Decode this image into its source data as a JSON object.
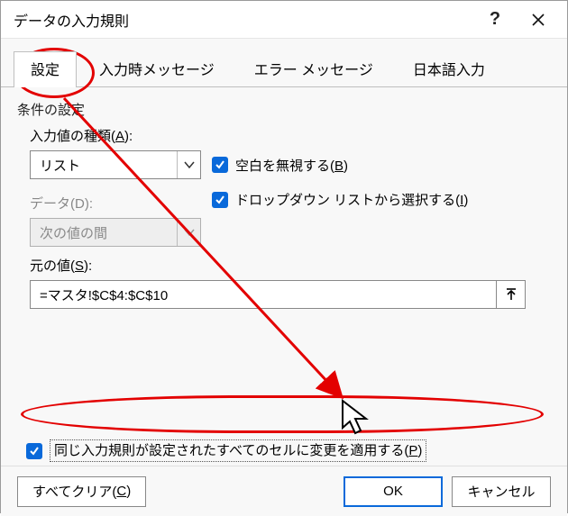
{
  "title": "データの入力規則",
  "tabs": [
    {
      "label": "設定",
      "active": true
    },
    {
      "label": "入力時メッセージ",
      "active": false
    },
    {
      "label": "エラー メッセージ",
      "active": false
    },
    {
      "label": "日本語入力",
      "active": false
    }
  ],
  "group_label": "条件の設定",
  "allow": {
    "label_pre": "入力値の種類(",
    "mnemonic": "A",
    "label_post": "):",
    "value": "リスト"
  },
  "data_menu": {
    "label_pre": "データ(",
    "mnemonic": "D",
    "label_post": "):",
    "value": "次の値の間",
    "disabled": true
  },
  "ignore_blank": {
    "checked": true,
    "label_pre": "空白を無視する(",
    "mnemonic": "B",
    "label_post": ")"
  },
  "incell_dropdown": {
    "checked": true,
    "label_pre": "ドロップダウン リストから選択する(",
    "mnemonic": "I",
    "label_post": ")"
  },
  "source": {
    "label_pre": "元の値(",
    "mnemonic": "S",
    "label_post": "):",
    "value": "=マスタ!$C$4:$C$10"
  },
  "apply_all": {
    "checked": true,
    "label_pre": "同じ入力規則が設定されたすべてのセルに変更を適用する(",
    "mnemonic": "P",
    "label_post": ")"
  },
  "buttons": {
    "clear_pre": "すべてクリア(",
    "clear_mn": "C",
    "clear_post": ")",
    "ok": "OK",
    "cancel": "キャンセル"
  }
}
